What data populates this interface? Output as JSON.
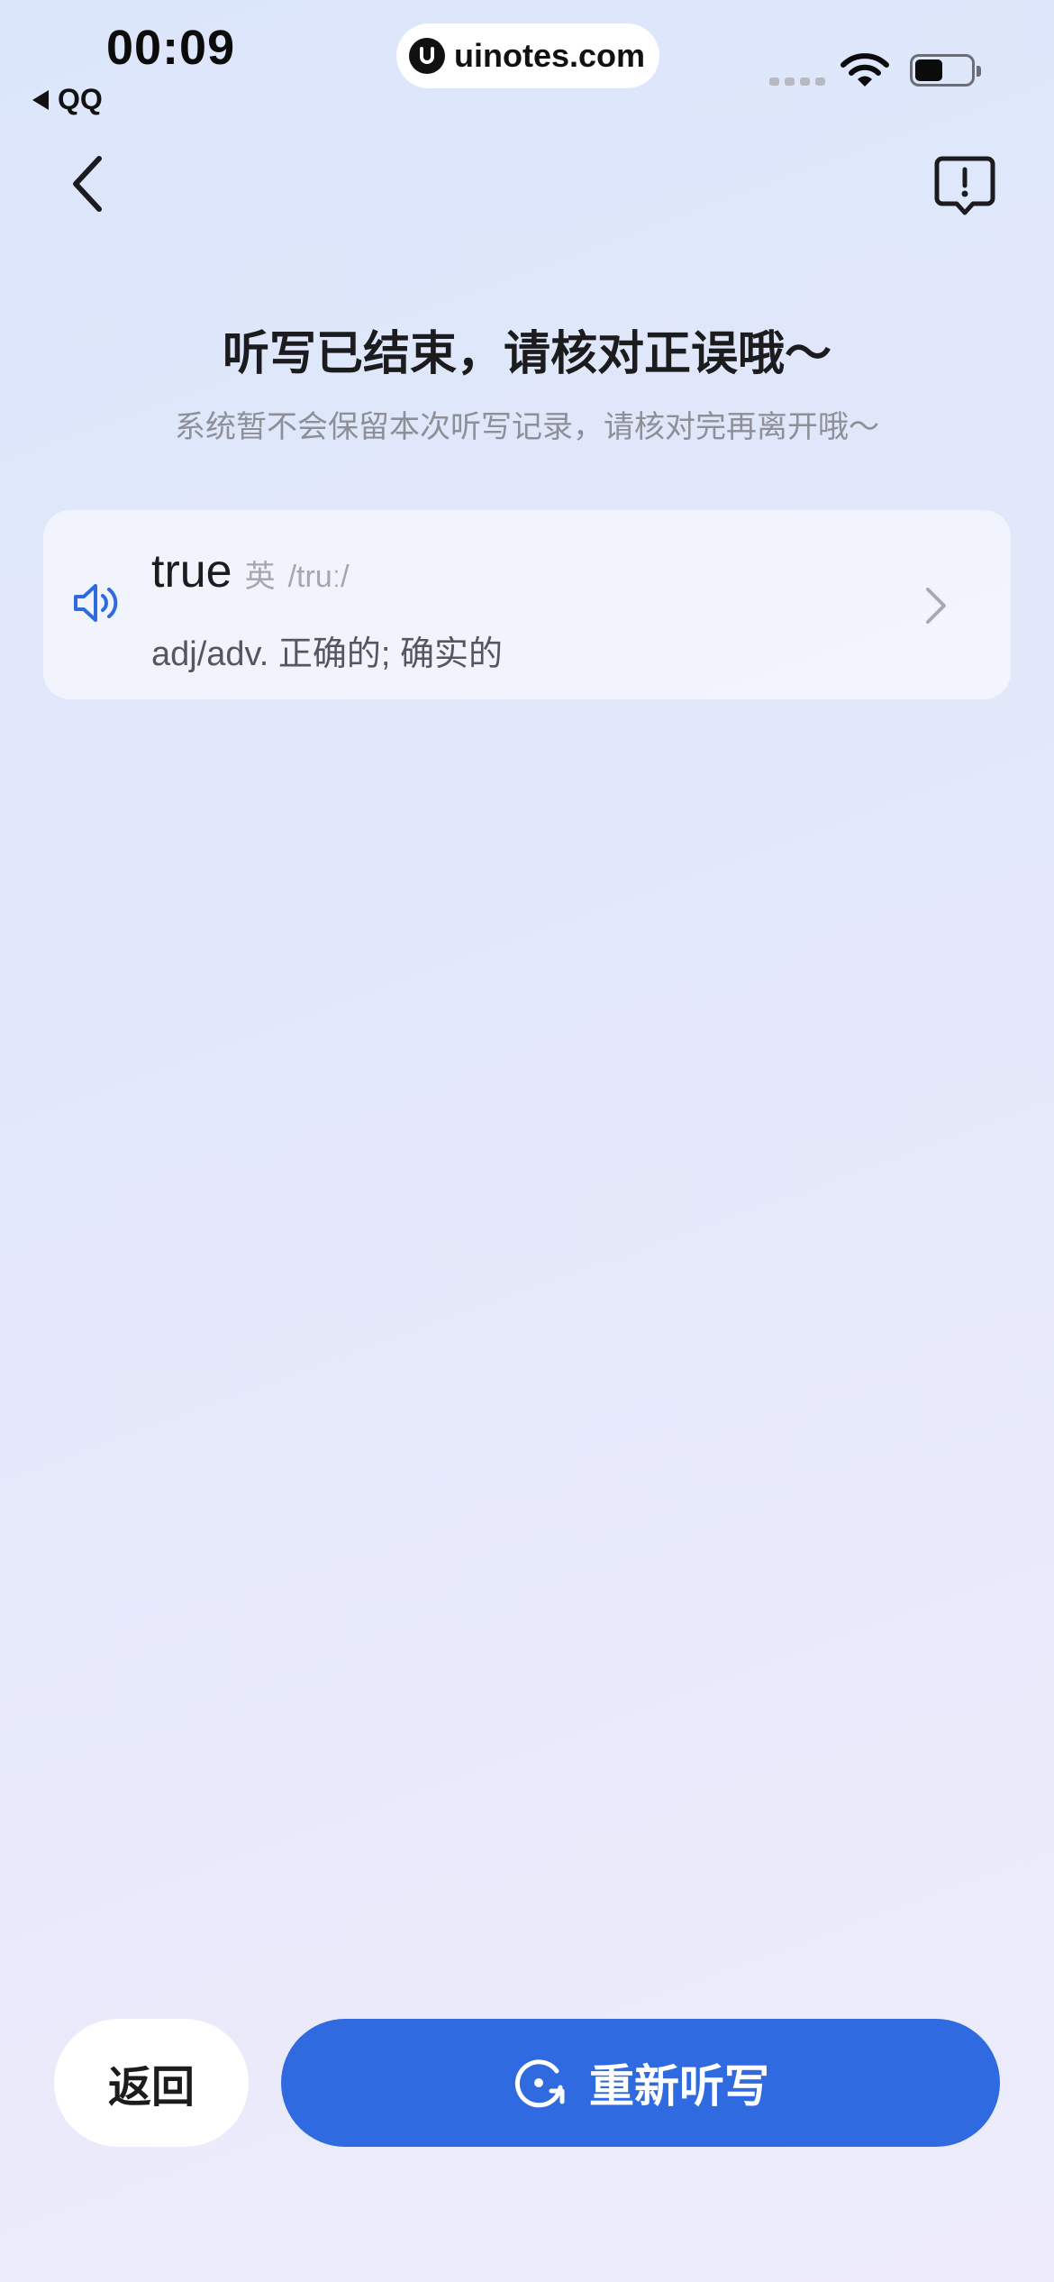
{
  "status_bar": {
    "time": "00:09",
    "back_app": "QQ",
    "site": "uinotes.com",
    "icons": [
      "signal-icon",
      "wifi-icon",
      "battery-icon"
    ]
  },
  "header": {
    "back_icon": "chevron-left-icon",
    "report_icon": "report-icon"
  },
  "main": {
    "title": "听写已结束，请核对正误哦～",
    "subtitle": "系统暂不会保留本次听写记录，请核对完再离开哦～"
  },
  "words": [
    {
      "word": "true",
      "lang": "英",
      "phonetic": "/truː/",
      "meaning": "adj/adv. 正确的; 确实的"
    }
  ],
  "buttons": {
    "return_label": "返回",
    "redo_label": "重新听写"
  },
  "colors": {
    "accent": "#306ae0",
    "text": "#1c1c1e",
    "muted": "#8e9097"
  }
}
